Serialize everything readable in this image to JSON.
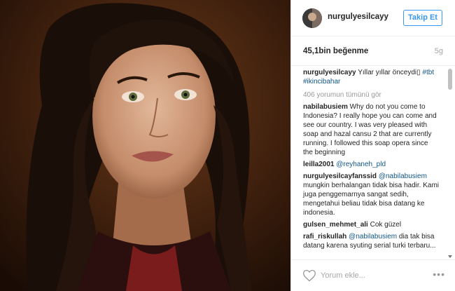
{
  "post": {
    "username": "nurgulyesilcayy",
    "follow_label": "Takip Et",
    "likes": "45,1bin beğenme",
    "age": "5g"
  },
  "caption": {
    "user": "nurgulyesilcayy",
    "text": " Yıllar yıllar önceydi",
    "box": "▯",
    "tag1": " #tbt",
    "tag2": "#ikincibahar"
  },
  "load_more": "406 yorumun tümünü gör",
  "comments": [
    {
      "user": "nabilabusiem",
      "mention": "",
      "text": " Why do not you come to Indonesia? I really hope you can come and see our country. I was very pleased with soap and hazal cansu 2 that are currently running. I followed this soap opera since the beginning"
    },
    {
      "user": "leilla2001",
      "mention": " @reyhaneh_pld",
      "text": ""
    },
    {
      "user": "nurgulyesilcayfanssid",
      "mention": " @nabilabusiem",
      "text": " mungkin berhalangan tidak bisa hadir. Kami juga penggemarnya sangat sedih, mengetahui beliau tidak bisa datang ke indonesia."
    },
    {
      "user": "gulsen_mehmet_ali",
      "mention": "",
      "text": " Cok güzel"
    },
    {
      "user": "rafi_riskullah",
      "mention": " @nabilabusiem",
      "text": " dia tak bisa datang karena syuting serial turki terbaru..."
    }
  ],
  "footer": {
    "placeholder": "Yorum ekle...",
    "more_glyph": "•••"
  },
  "colors": {
    "accent": "#3897f0",
    "link": "#125688"
  }
}
